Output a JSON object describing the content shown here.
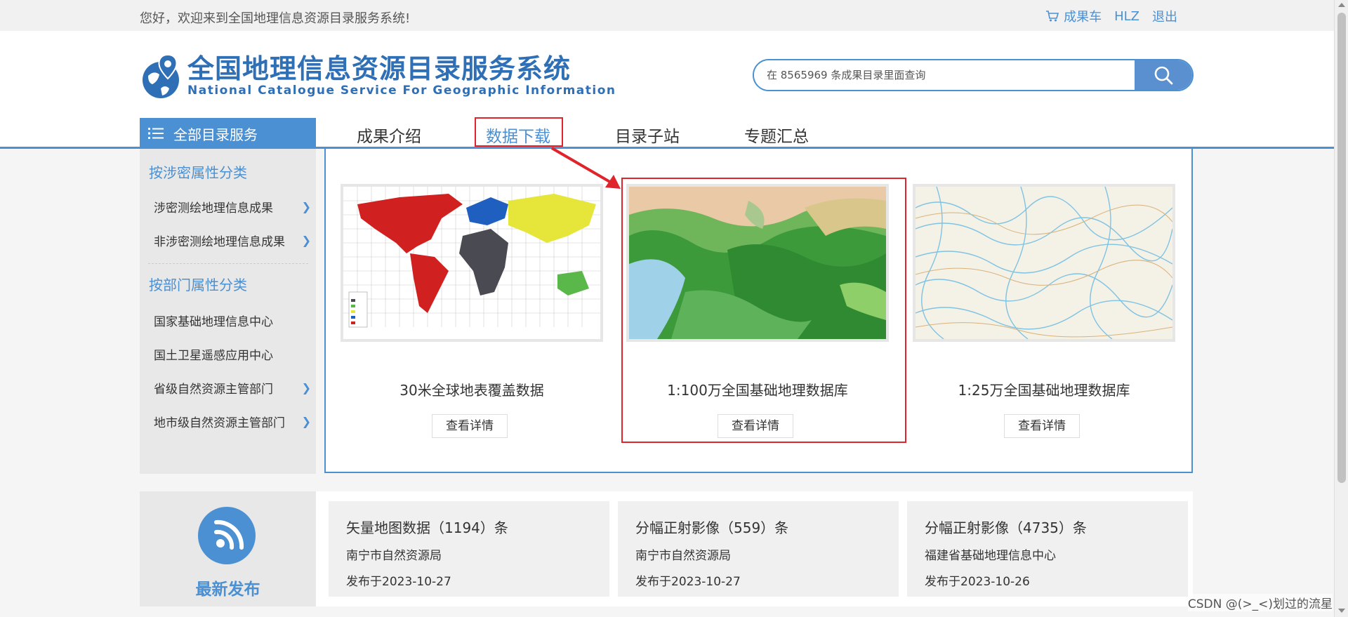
{
  "topbar": {
    "welcome": "您好，欢迎来到全国地理信息资源目录服务系统!",
    "cart": "成果车",
    "user": "HLZ",
    "logout": "退出"
  },
  "logo": {
    "title_cn": "全国地理信息资源目录服务系统",
    "title_en": "National Catalogue Service For Geographic Information"
  },
  "search": {
    "placeholder": "在 8565969 条成果目录里面查询"
  },
  "nav": {
    "all_catalog": "全部目录服务",
    "items": [
      "成果介绍",
      "数据下载",
      "目录子站",
      "专题汇总"
    ],
    "active": "数据下载"
  },
  "sidebar": {
    "group1": "按涉密属性分类",
    "group1_items": [
      "涉密测绘地理信息成果",
      "非涉密测绘地理信息成果"
    ],
    "group2": "按部门属性分类",
    "group2_items": [
      "国家基础地理信息中心",
      "国土卫星遥感应用中心",
      "省级自然资源主管部门",
      "地市级自然资源主管部门"
    ]
  },
  "cards": [
    {
      "label": "30米全球地表覆盖数据",
      "button": "查看详情"
    },
    {
      "label": "1:100万全国基础地理数据库",
      "button": "查看详情"
    },
    {
      "label": "1:25万全国基础地理数据库",
      "button": "查看详情"
    }
  ],
  "latest": {
    "label": "最新发布",
    "items": [
      {
        "title": "矢量地图数据（1194）条",
        "source": "南宁市自然资源局",
        "date": "发布于2023-10-27"
      },
      {
        "title": "分幅正射影像（559）条",
        "source": "南宁市自然资源局",
        "date": "发布于2023-10-27"
      },
      {
        "title": "分幅正射影像（4735）条",
        "source": "福建省基础地理信息中心",
        "date": "发布于2023-10-26"
      }
    ]
  },
  "watermark": "CSDN @(>_<)划过的流星",
  "colors": {
    "accent": "#4a90d2",
    "highlight": "#e0242b"
  }
}
